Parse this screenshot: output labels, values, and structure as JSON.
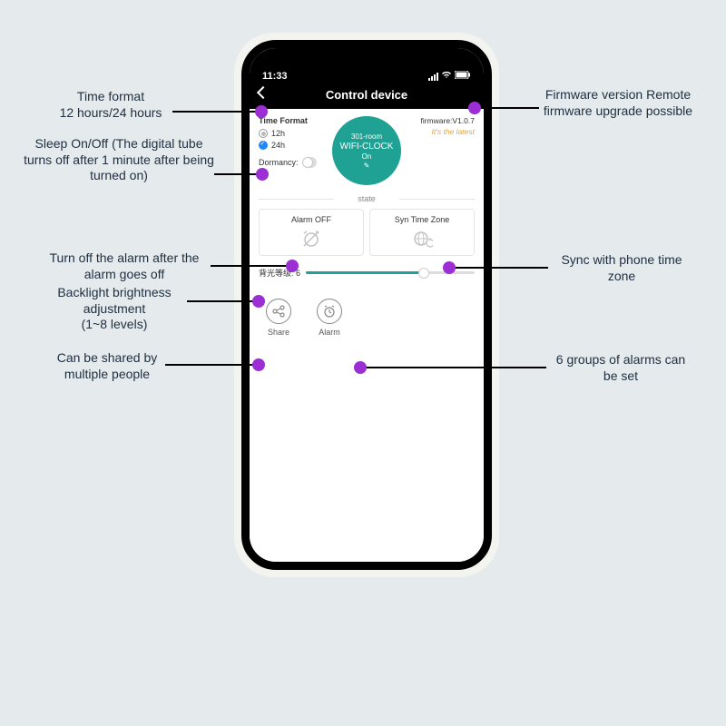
{
  "status": {
    "time": "11:33"
  },
  "header": {
    "title": "Control device"
  },
  "timeFormat": {
    "title": "Time Format",
    "opt12": "12h",
    "opt24": "24h"
  },
  "dormancy": {
    "label": "Dormancy:"
  },
  "device": {
    "room": "301-room",
    "name": "WIFI-CLOCK",
    "status": "On",
    "edit": "✎"
  },
  "firmware": {
    "label": "firmware:V1.0.7",
    "latest": "It's the latest"
  },
  "state": {
    "label": "state"
  },
  "cards": {
    "alarm": "Alarm OFF",
    "sync": "Syn Time Zone"
  },
  "brightness": {
    "label": "背光等级: 6"
  },
  "bottom": {
    "share": "Share",
    "alarm": "Alarm"
  },
  "callouts": {
    "timeformat": "Time format\n12 hours/24 hours",
    "sleep": "Sleep On/Off (The digital tube turns off after 1 minute after being turned on)",
    "alarmoff": "Turn off the alarm after the alarm goes off",
    "backlight": "Backlight brightness adjustment\n(1~8 levels)",
    "share": "Can be shared by multiple people",
    "firmware": "Firmware version Remote firmware upgrade possible",
    "sync": "Sync with phone time zone",
    "alarms6": "6 groups of alarms can be set"
  }
}
